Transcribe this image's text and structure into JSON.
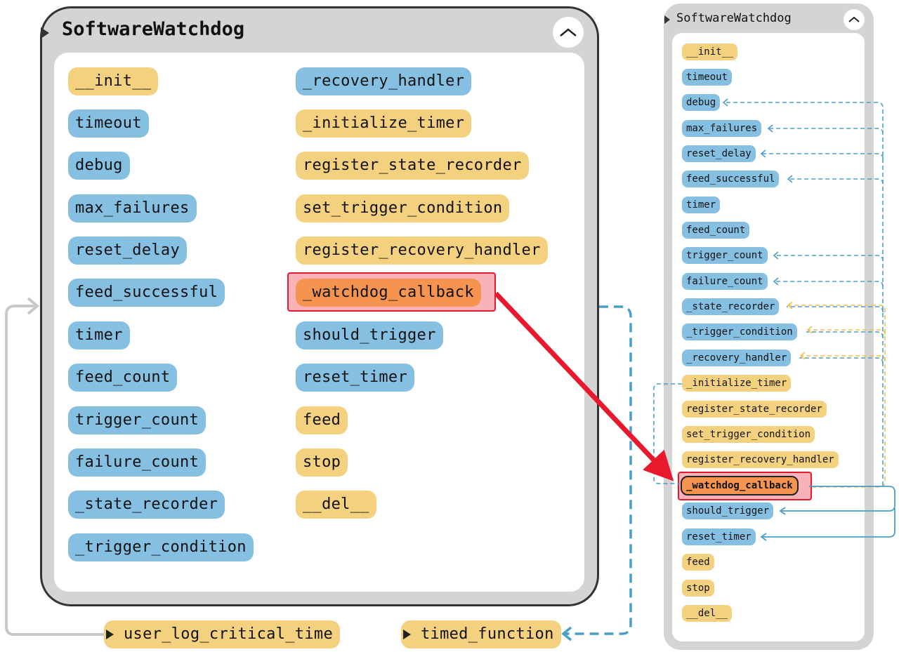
{
  "main": {
    "title": "SoftwareWatchdog",
    "col1": [
      "__init__",
      "timeout",
      "debug",
      "max_failures",
      "reset_delay",
      "feed_successful",
      "timer",
      "feed_count",
      "trigger_count",
      "failure_count",
      "_state_recorder",
      "_trigger_condition"
    ],
    "col2": [
      "_recovery_handler",
      "_initialize_timer",
      "register_state_recorder",
      "set_trigger_condition",
      "register_recovery_handler",
      "_watchdog_callback",
      "should_trigger",
      "reset_timer",
      "feed",
      "stop",
      "__del__"
    ]
  },
  "side": {
    "title": "SoftwareWatchdog",
    "items": [
      "__init__",
      "timeout",
      "debug",
      "max_failures",
      "reset_delay",
      "feed_successful",
      "timer",
      "feed_count",
      "trigger_count",
      "failure_count",
      "_state_recorder",
      "_trigger_condition",
      "_recovery_handler",
      "_initialize_timer",
      "register_state_recorder",
      "set_trigger_condition",
      "register_recovery_handler",
      "_watchdog_callback",
      "should_trigger",
      "reset_timer",
      "feed",
      "stop",
      "__del__"
    ]
  },
  "external": {
    "user_log_critical_time": "user_log_critical_time",
    "timed_function": "timed_function"
  },
  "colors": {
    "attribute": "#85c0e3",
    "method": "#f4d17e",
    "selected": "#f4944f",
    "highlight_border": "#e8192c",
    "edge_blue": "#4a9ec7",
    "edge_yellow": "#f2c14e",
    "edge_gray": "#c8c8c8"
  }
}
